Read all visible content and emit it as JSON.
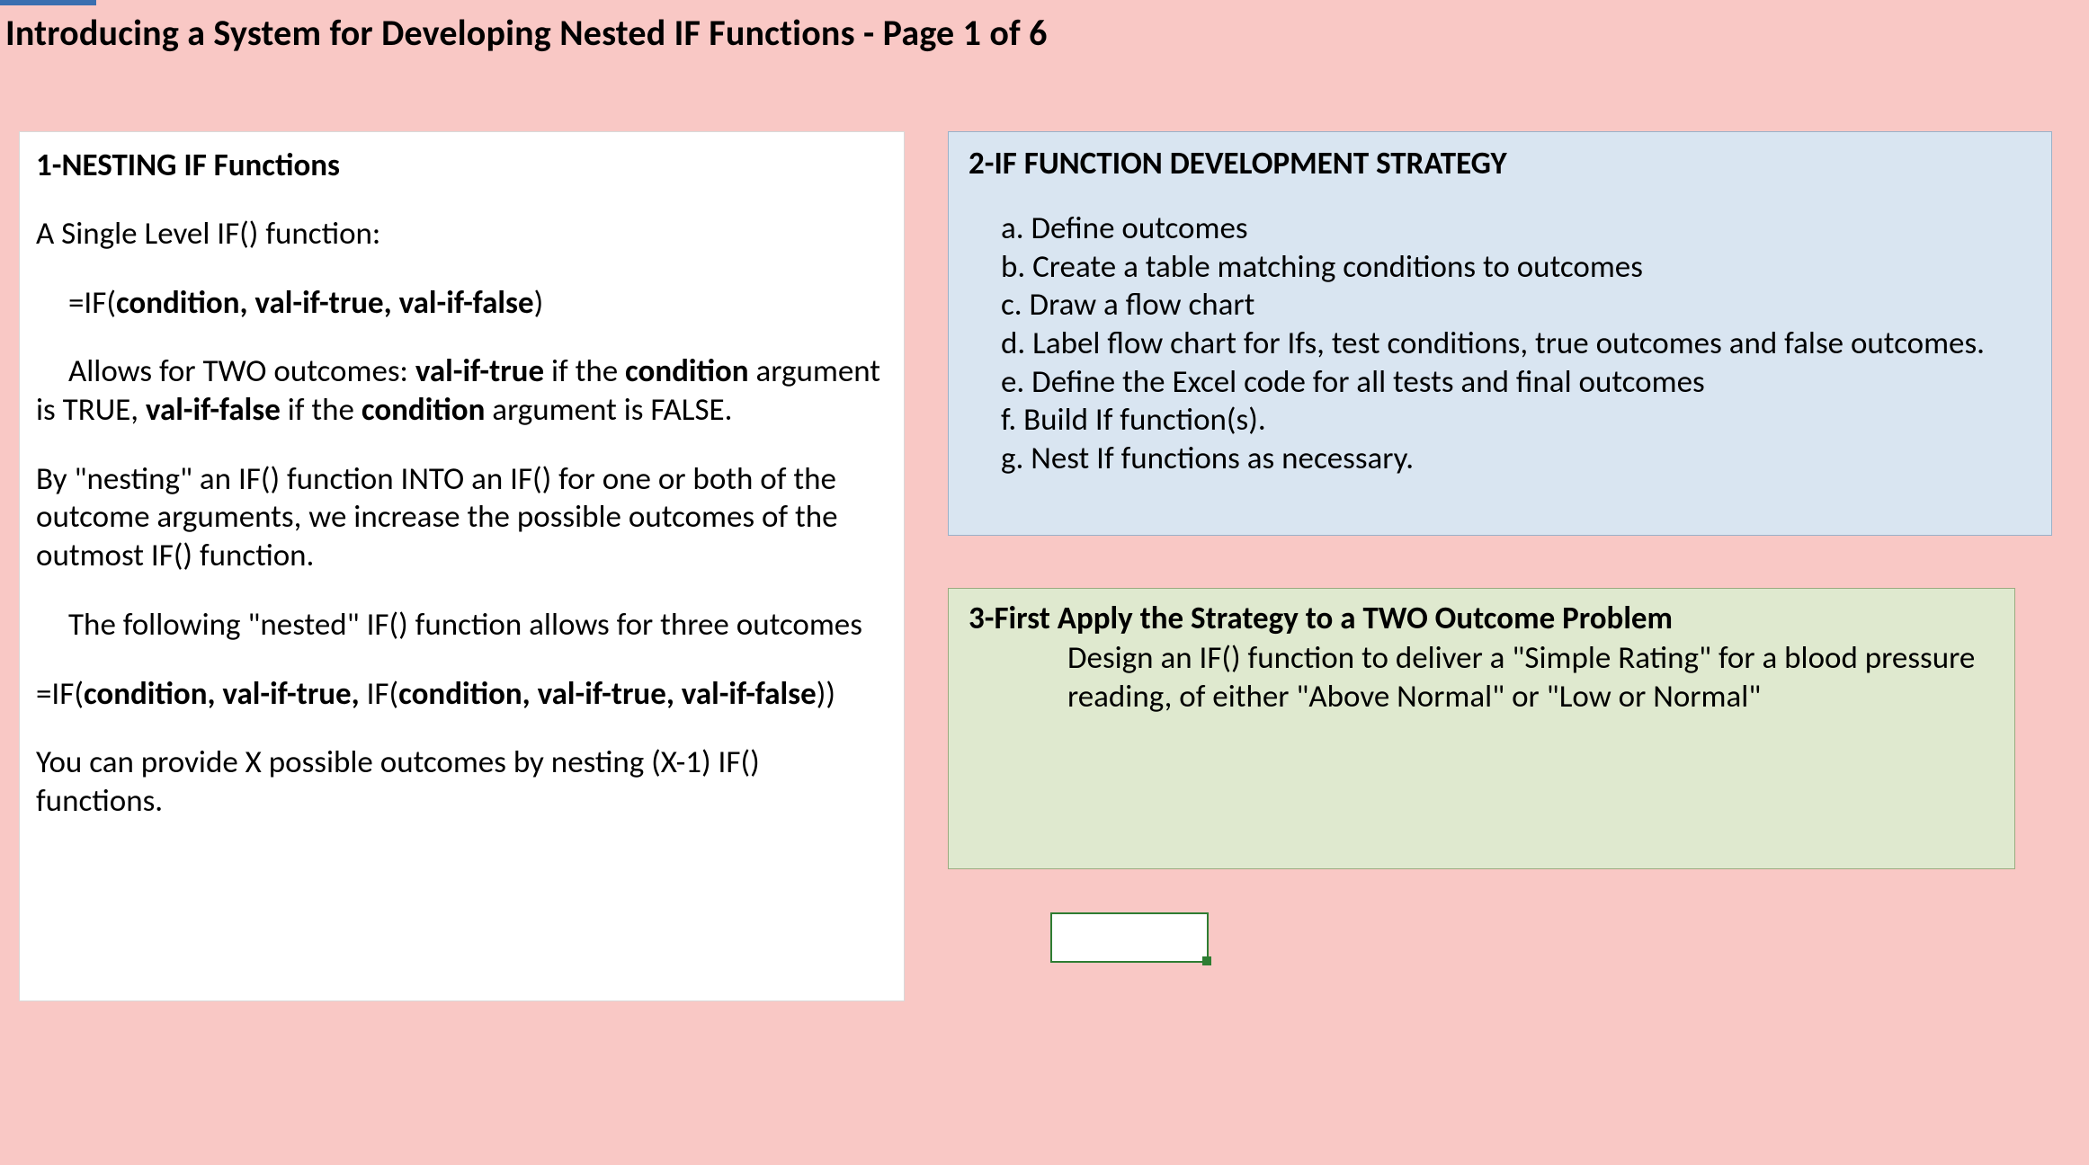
{
  "title": "Introducing a System for Developing Nested IF Functions - Page 1 of 6",
  "box1": {
    "heading": "1-NESTING IF Functions",
    "p1": "A Single Level IF() function:",
    "formula1_pre": "=IF(",
    "formula1_args": "condition, val-if-true, val-if-false",
    "formula1_post": ")",
    "p2a": "Allows for TWO outcomes: ",
    "p2b": "val-if-true",
    "p2c": " if the ",
    "p2d": "condition",
    "p2e": " argument is TRUE, ",
    "p2f": "val-if-false",
    "p2g": " if the ",
    "p2h": "condition",
    "p2i": " argument is FALSE.",
    "p3": "By \"nesting\" an IF() function INTO an IF()  for one or both of the outcome arguments, we increase the possible outcomes of the outmost IF() function.",
    "p4": "The following \"nested\" IF() function allows for three outcomes",
    "formula2_a": "=IF(",
    "formula2_b": "condition, val-if-true, ",
    "formula2_c": "IF(",
    "formula2_d": "condition, val-if-true, val-if-false",
    "formula2_e": "))",
    "p5": "You can provide X possible outcomes by nesting (X-1) IF() functions."
  },
  "box2": {
    "heading": "2-IF FUNCTION DEVELOPMENT STRATEGY",
    "items": {
      "a": "a. Define outcomes",
      "b": "b. Create a table matching conditions to outcomes",
      "c": "c. Draw a flow chart",
      "d": "d. Label flow chart for Ifs, test conditions, true outcomes and false outcomes.",
      "e": "e. Define the Excel code for all tests and final outcomes",
      "f": "f. Build If function(s).",
      "g": "g. Nest If functions as necessary."
    }
  },
  "box3": {
    "heading": "3-First Apply the Strategy to a TWO Outcome Problem",
    "desc": "Design an IF() function to deliver a \"Simple Rating\" for a blood pressure reading, of either \"Above Normal\" or \"Low or Normal\""
  }
}
